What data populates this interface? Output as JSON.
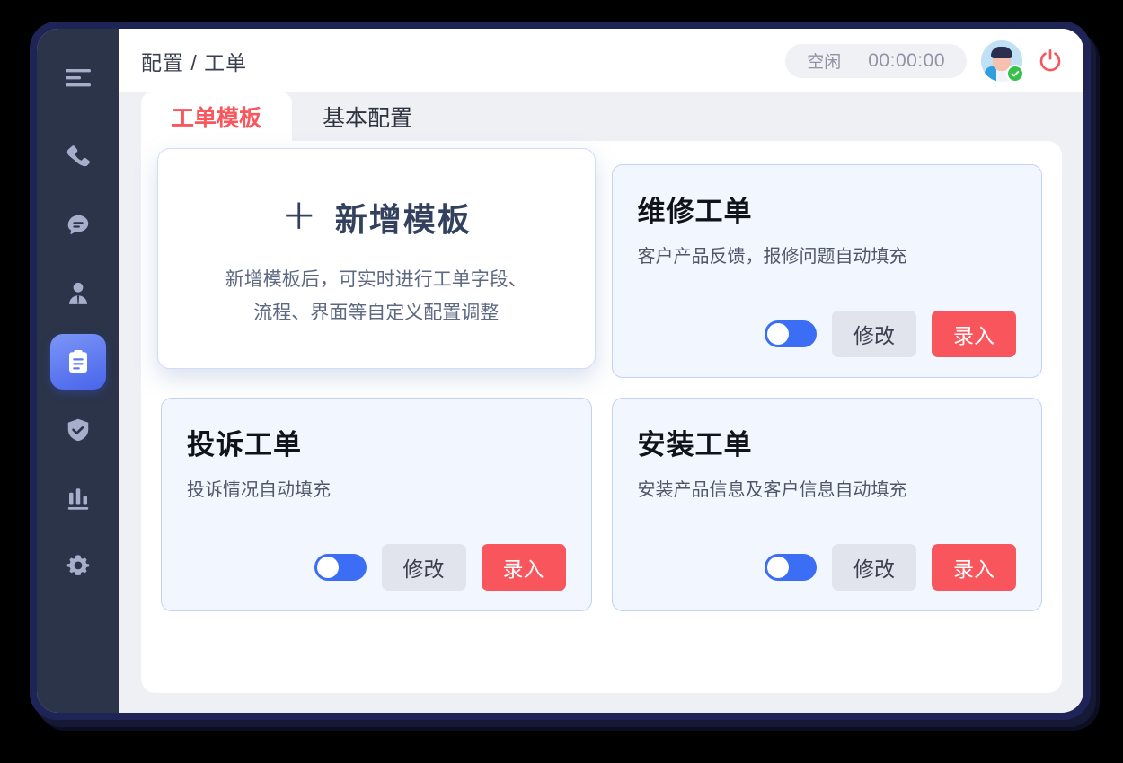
{
  "sidebar": {
    "items": [
      {
        "name": "menu",
        "icon": "hamburger-menu-icon",
        "active": false
      },
      {
        "name": "calls",
        "icon": "phone-icon",
        "active": false
      },
      {
        "name": "messages",
        "icon": "chat-bubble-icon",
        "active": false
      },
      {
        "name": "agents",
        "icon": "user-icon",
        "active": false
      },
      {
        "name": "tickets",
        "icon": "clipboard-icon",
        "active": true
      },
      {
        "name": "quality",
        "icon": "shield-check-icon",
        "active": false
      },
      {
        "name": "reports",
        "icon": "bar-chart-icon",
        "active": false
      },
      {
        "name": "settings",
        "icon": "gear-icon",
        "active": false
      }
    ]
  },
  "header": {
    "breadcrumb": "配置 / 工单",
    "status_label": "空闲",
    "timer": "00:00:00",
    "avatar_alt": "坐席头像",
    "power_icon": "power-icon"
  },
  "tabs": [
    {
      "label": "工单模板",
      "active": true
    },
    {
      "label": "基本配置",
      "active": false
    }
  ],
  "new_template_card": {
    "plus": "＋",
    "title": "新增模板",
    "desc_line1": "新增模板后，可实时进行工单字段、",
    "desc_line2": "流程、界面等自定义配置调整"
  },
  "buttons": {
    "edit": "修改",
    "enter": "录入"
  },
  "templates": [
    {
      "title": "维修工单",
      "desc": "客户产品反馈，报修问题自动填充",
      "enabled": true
    },
    {
      "title": "投诉工单",
      "desc": "投诉情况自动填充",
      "enabled": true
    },
    {
      "title": "安装工单",
      "desc": "安装产品信息及客户信息自动填充",
      "enabled": true
    }
  ],
  "colors": {
    "frame": "#1f2457",
    "sidebar": "#2b3448",
    "accent_blue": "#3b6ef5",
    "accent_red": "#f9555d",
    "card_fill": "#f2f6fe",
    "card_border": "#c3d2f2",
    "panel_bg": "#eef0f4"
  }
}
